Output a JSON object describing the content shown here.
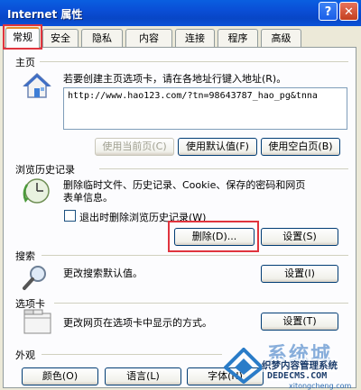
{
  "window": {
    "title": "Internet 属性",
    "help_label": "?",
    "close_label": "✕"
  },
  "tabs": [
    "常规",
    "安全",
    "隐私",
    "内容",
    "连接",
    "程序",
    "高级"
  ],
  "home": {
    "group_label": "主页",
    "description": "若要创建主页选项卡，请在各地址行键入地址(R)。",
    "url": "http://www.hao123.com/?tn=98643787_hao_pg&tnna",
    "btn_current": "使用当前页(C)",
    "btn_default": "使用默认值(F)",
    "btn_blank": "使用空白页(B)"
  },
  "history": {
    "group_label": "浏览历史记录",
    "description_1": "删除临时文件、历史记录、Cookie、保存的密码和网页",
    "description_2": "表单信息。",
    "checkbox_label": "退出时删除浏览历史记录(W)",
    "btn_delete": "删除(D)...",
    "btn_settings": "设置(S)"
  },
  "search": {
    "group_label": "搜索",
    "description": "更改搜索默认值。",
    "btn_settings": "设置(I)"
  },
  "tabs_section": {
    "group_label": "选项卡",
    "description": "更改网页在选项卡中显示的方式。",
    "btn_settings": "设置(T)"
  },
  "appearance": {
    "group_label": "外观",
    "btn_colors": "颜色(O)",
    "btn_languages": "语言(L)",
    "btn_fonts": "字体(N)"
  },
  "watermark": {
    "brand": "系统城",
    "line1": "织梦内容管理系统",
    "line2": "DEDECMS.COM",
    "line3": "xitongcheng.com"
  },
  "icons": {
    "home": "house-icon",
    "history": "history-clock-icon",
    "search": "magnifier-icon",
    "tabs": "tabbed-window-icon"
  },
  "colors": {
    "title_bar": "#0a52d8",
    "dialog_bg": "#ece9d8",
    "panel_bg": "#fcfcfe",
    "highlight": "#e0343e",
    "active_tab_top": "#e68b2c"
  }
}
